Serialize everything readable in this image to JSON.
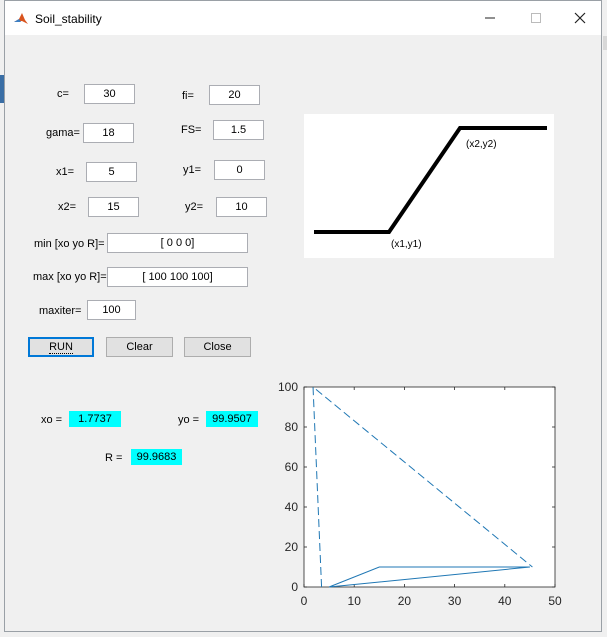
{
  "window": {
    "title": "Soil_stability"
  },
  "inputs": {
    "c": {
      "label": "c=",
      "value": "30"
    },
    "fi": {
      "label": "fi=",
      "value": "20"
    },
    "gama": {
      "label": "gama=",
      "value": "18"
    },
    "fs": {
      "label": "FS=",
      "value": "1.5"
    },
    "x1": {
      "label": "x1=",
      "value": "5"
    },
    "y1": {
      "label": "y1=",
      "value": "0"
    },
    "x2": {
      "label": "x2=",
      "value": "15"
    },
    "y2": {
      "label": "y2=",
      "value": "10"
    },
    "min": {
      "label": "min [xo yo R]=",
      "value": "[ 0 0 0]"
    },
    "max": {
      "label": "max [xo yo R]=",
      "value": "[ 100 100 100]"
    },
    "maxiter": {
      "label": "maxiter=",
      "value": "100"
    }
  },
  "buttons": {
    "run": "RUN",
    "clear": "Clear",
    "close": "Close"
  },
  "results": {
    "xo": {
      "label": "xo =",
      "value": "1.7737"
    },
    "yo": {
      "label": "yo =",
      "value": "99.9507"
    },
    "r": {
      "label": "R =",
      "value": "99.9683"
    },
    "color": "#00ffff"
  },
  "schematic": {
    "label_p1": "(x1,y1)",
    "label_p2": "(x2,y2)"
  },
  "chart_data": {
    "type": "line",
    "xlim": [
      0,
      50
    ],
    "ylim": [
      0,
      100
    ],
    "x_ticks": [
      "0",
      "10",
      "20",
      "30",
      "40",
      "50"
    ],
    "y_ticks": [
      "0",
      "20",
      "40",
      "60",
      "80",
      "100"
    ],
    "color": "#1f77b4",
    "series": [
      {
        "style": "solid",
        "points": [
          [
            5,
            0
          ],
          [
            15,
            10
          ],
          [
            45,
            10
          ],
          [
            5,
            0
          ]
        ]
      },
      {
        "style": "dashed",
        "points": [
          [
            3.5,
            0
          ],
          [
            1.8,
            100
          ],
          [
            45.5,
            10
          ]
        ]
      }
    ]
  }
}
